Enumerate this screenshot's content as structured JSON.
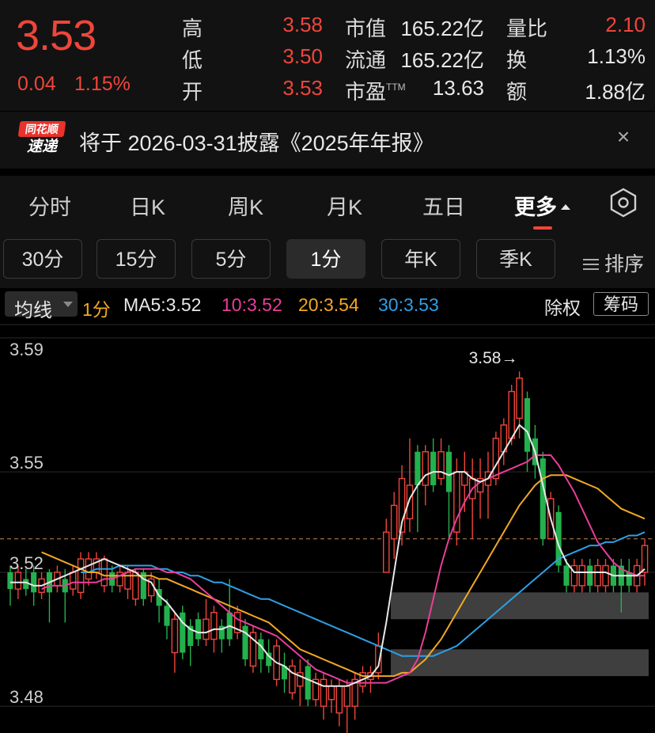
{
  "quote": {
    "price": "3.53",
    "change": "0.04",
    "change_pct": "1.15%",
    "metrics": [
      {
        "label": "高",
        "value": "3.58"
      },
      {
        "label": "低",
        "value": "3.50"
      },
      {
        "label": "开",
        "value": "3.53"
      }
    ],
    "stats_mid": [
      {
        "label": "市值",
        "value": "165.22亿"
      },
      {
        "label": "流通",
        "value": "165.22亿"
      },
      {
        "label": "市盈",
        "label_suffix": "TTM",
        "value": "13.63"
      }
    ],
    "stats_right": [
      {
        "label": "量比",
        "value": "2.10"
      },
      {
        "label": "换",
        "value": "1.13%"
      },
      {
        "label": "额",
        "value": "1.88亿"
      }
    ]
  },
  "news": {
    "logo_top": "同花顺",
    "logo_bottom": "速递",
    "text": "将于 2026-03-31披露《2025年年报》",
    "close": "×"
  },
  "tabs": [
    "分时",
    "日K",
    "周K",
    "月K",
    "五日",
    "更多"
  ],
  "tabs_active": "更多",
  "sub_periods": [
    "30分",
    "15分",
    "5分",
    "1分",
    "年K",
    "季K"
  ],
  "sub_active": "1分",
  "sort_label": "排序",
  "indicator": {
    "selector": "均线",
    "period": "1分",
    "ma5": "MA5:3.52",
    "ma10": "10:3.52",
    "ma20": "20:3.54",
    "ma30": "30:3.53",
    "fq": "除权",
    "chip": "筹码"
  },
  "colors": {
    "up": "#f0453a",
    "down": "#23b14d",
    "ma5": "#e8e8e8",
    "ma10": "#e83e9a",
    "ma20": "#f2a824",
    "ma30": "#2e9fe6",
    "period": "#f2a824"
  },
  "chart_data": {
    "type": "candlestick",
    "y_ticks": [
      "3.59",
      "3.55",
      "3.52",
      "3.48"
    ],
    "max_label": "3.58→",
    "ylim": [
      3.472,
      3.594
    ],
    "last_price": 3.53,
    "chip_band": [
      {
        "y_from": 3.506,
        "y_to": 3.514
      },
      {
        "y_from": 3.489,
        "y_to": 3.497
      }
    ],
    "candles": [
      [
        3.52,
        3.515,
        3.522,
        3.51
      ],
      [
        3.515,
        3.52,
        3.522,
        3.512
      ],
      [
        3.518,
        3.515,
        3.521,
        3.513
      ],
      [
        3.52,
        3.514,
        3.522,
        3.51
      ],
      [
        3.514,
        3.518,
        3.52,
        3.512
      ],
      [
        3.52,
        3.514,
        3.521,
        3.505
      ],
      [
        3.516,
        3.52,
        3.522,
        3.514
      ],
      [
        3.518,
        3.514,
        3.521,
        3.505
      ],
      [
        3.515,
        3.52,
        3.522,
        3.513
      ],
      [
        3.514,
        3.524,
        3.526,
        3.512
      ],
      [
        3.518,
        3.524,
        3.526,
        3.516
      ],
      [
        3.52,
        3.524,
        3.526,
        3.518
      ],
      [
        3.516,
        3.524,
        3.525,
        3.514
      ],
      [
        3.52,
        3.516,
        3.522,
        3.514
      ],
      [
        3.516,
        3.52,
        3.522,
        3.514
      ],
      [
        3.515,
        3.52,
        3.522,
        3.512
      ],
      [
        3.512,
        3.52,
        3.521,
        3.51
      ],
      [
        3.52,
        3.512,
        3.521,
        3.51
      ],
      [
        3.513,
        3.518,
        3.52,
        3.511
      ],
      [
        3.515,
        3.51,
        3.518,
        3.505
      ],
      [
        3.51,
        3.504,
        3.512,
        3.5
      ],
      [
        3.496,
        3.506,
        3.508,
        3.49
      ],
      [
        3.508,
        3.496,
        3.51,
        3.494
      ],
      [
        3.504,
        3.498,
        3.506,
        3.492
      ],
      [
        3.506,
        3.5,
        3.508,
        3.498
      ],
      [
        3.5,
        3.506,
        3.512,
        3.498
      ],
      [
        3.5,
        3.508,
        3.51,
        3.496
      ],
      [
        3.504,
        3.5,
        3.506,
        3.496
      ],
      [
        3.508,
        3.5,
        3.518,
        3.498
      ],
      [
        3.502,
        3.508,
        3.51,
        3.5
      ],
      [
        3.504,
        3.494,
        3.506,
        3.492
      ],
      [
        3.492,
        3.502,
        3.504,
        3.49
      ],
      [
        3.5,
        3.494,
        3.502,
        3.49
      ],
      [
        3.496,
        3.492,
        3.5,
        3.49
      ],
      [
        3.488,
        3.498,
        3.5,
        3.486
      ],
      [
        3.492,
        3.488,
        3.496,
        3.484
      ],
      [
        3.484,
        3.492,
        3.494,
        3.482
      ],
      [
        3.486,
        3.49,
        3.494,
        3.48
      ],
      [
        3.492,
        3.482,
        3.494,
        3.48
      ],
      [
        3.482,
        3.488,
        3.49,
        3.48
      ],
      [
        3.48,
        3.488,
        3.49,
        3.476
      ],
      [
        3.482,
        3.486,
        3.488,
        3.478
      ],
      [
        3.478,
        3.486,
        3.488,
        3.474
      ],
      [
        3.48,
        3.486,
        3.488,
        3.47
      ],
      [
        3.48,
        3.488,
        3.49,
        3.476
      ],
      [
        3.486,
        3.49,
        3.492,
        3.484
      ],
      [
        3.488,
        3.49,
        3.492,
        3.484
      ],
      [
        3.49,
        3.498,
        3.502,
        3.488
      ],
      [
        3.52,
        3.532,
        3.536,
        3.52
      ],
      [
        3.53,
        3.54,
        3.544,
        3.524
      ],
      [
        3.532,
        3.548,
        3.552,
        3.528
      ],
      [
        3.536,
        3.546,
        3.56,
        3.532
      ],
      [
        3.556,
        3.546,
        3.558,
        3.532
      ],
      [
        3.546,
        3.556,
        3.558,
        3.54
      ],
      [
        3.556,
        3.546,
        3.56,
        3.544
      ],
      [
        3.548,
        3.556,
        3.56,
        3.546
      ],
      [
        3.556,
        3.544,
        3.558,
        3.53
      ],
      [
        3.532,
        3.55,
        3.554,
        3.528
      ],
      [
        3.546,
        3.55,
        3.556,
        3.538
      ],
      [
        3.542,
        3.548,
        3.554,
        3.53
      ],
      [
        3.544,
        3.548,
        3.554,
        3.536
      ],
      [
        3.546,
        3.55,
        3.556,
        3.536
      ],
      [
        3.548,
        3.56,
        3.562,
        3.546
      ],
      [
        3.556,
        3.564,
        3.566,
        3.552
      ],
      [
        3.56,
        3.574,
        3.576,
        3.558
      ],
      [
        3.566,
        3.578,
        3.58,
        3.56
      ],
      [
        3.572,
        3.556,
        3.574,
        3.55
      ],
      [
        3.56,
        3.552,
        3.564,
        3.548
      ],
      [
        3.554,
        3.53,
        3.556,
        3.528
      ],
      [
        3.53,
        3.542,
        3.544,
        3.53
      ],
      [
        3.538,
        3.522,
        3.54,
        3.52
      ],
      [
        3.522,
        3.516,
        3.524,
        3.514
      ],
      [
        3.516,
        3.522,
        3.524,
        3.514
      ],
      [
        3.516,
        3.522,
        3.524,
        3.514
      ],
      [
        3.522,
        3.516,
        3.524,
        3.514
      ],
      [
        3.516,
        3.522,
        3.524,
        3.514
      ],
      [
        3.516,
        3.522,
        3.524,
        3.514
      ],
      [
        3.522,
        3.516,
        3.524,
        3.514
      ],
      [
        3.522,
        3.516,
        3.524,
        3.508
      ],
      [
        3.52,
        3.516,
        3.524,
        3.514
      ],
      [
        3.516,
        3.522,
        3.524,
        3.514
      ],
      [
        3.52,
        3.528,
        3.53,
        3.516
      ]
    ],
    "ma5": [
      3.517,
      3.517,
      3.517,
      3.516,
      3.516,
      3.517,
      3.518,
      3.519,
      3.52,
      3.521,
      3.522,
      3.523,
      3.524,
      3.523,
      3.522,
      3.521,
      3.52,
      3.518,
      3.517,
      3.513,
      3.511,
      3.508,
      3.505,
      3.503,
      3.502,
      3.502,
      3.503,
      3.503,
      3.504,
      3.503,
      3.502,
      3.5,
      3.498,
      3.495,
      3.493,
      3.492,
      3.49,
      3.489,
      3.488,
      3.487,
      3.486,
      3.486,
      3.486,
      3.486,
      3.487,
      3.488,
      3.489,
      3.492,
      3.505,
      3.52,
      3.535,
      3.542,
      3.546,
      3.549,
      3.55,
      3.55,
      3.549,
      3.55,
      3.55,
      3.548,
      3.547,
      3.548,
      3.552,
      3.556,
      3.56,
      3.564,
      3.562,
      3.556,
      3.546,
      3.536,
      3.528,
      3.523,
      3.52,
      3.52,
      3.52,
      3.52,
      3.52,
      3.519,
      3.519,
      3.519,
      3.519,
      3.521
    ],
    "ma10": [
      3.515,
      3.516,
      3.516,
      3.516,
      3.517,
      3.517,
      3.517,
      3.517,
      3.518,
      3.518,
      3.519,
      3.52,
      3.521,
      3.521,
      3.521,
      3.521,
      3.52,
      3.52,
      3.519,
      3.518,
      3.516,
      3.514,
      3.512,
      3.51,
      3.508,
      3.506,
      3.505,
      3.504,
      3.503,
      3.502,
      3.501,
      3.499,
      3.497,
      3.495,
      3.493,
      3.491,
      3.49,
      3.489,
      3.488,
      3.487,
      3.487,
      3.487,
      3.487,
      3.487,
      3.487,
      3.488,
      3.489,
      3.49,
      3.494,
      3.502,
      3.512,
      3.522,
      3.53,
      3.536,
      3.541,
      3.545,
      3.547,
      3.548,
      3.549,
      3.55,
      3.551,
      3.552,
      3.553,
      3.555,
      3.555,
      3.555,
      3.552,
      3.548,
      3.544,
      3.539,
      3.534,
      3.529,
      3.526,
      3.523,
      3.521,
      3.52,
      3.519,
      3.519
    ],
    "ma20": [
      3.526,
      3.525,
      3.524,
      3.523,
      3.522,
      3.521,
      3.52,
      3.52,
      3.519,
      3.519,
      3.519,
      3.519,
      3.519,
      3.519,
      3.519,
      3.518,
      3.518,
      3.517,
      3.516,
      3.515,
      3.514,
      3.513,
      3.512,
      3.511,
      3.51,
      3.509,
      3.508,
      3.507,
      3.506,
      3.505,
      3.503,
      3.501,
      3.499,
      3.497,
      3.496,
      3.495,
      3.494,
      3.493,
      3.492,
      3.491,
      3.49,
      3.489,
      3.489,
      3.489,
      3.489,
      3.489,
      3.49,
      3.49,
      3.492,
      3.494,
      3.497,
      3.5,
      3.504,
      3.508,
      3.512,
      3.516,
      3.52,
      3.524,
      3.528,
      3.532,
      3.536,
      3.54,
      3.543,
      3.546,
      3.548,
      3.549,
      3.549,
      3.549,
      3.548,
      3.547,
      3.546,
      3.545,
      3.543,
      3.541,
      3.539,
      3.538,
      3.537,
      3.536
    ],
    "ma30": [
      3.52,
      3.52,
      3.521,
      3.521,
      3.521,
      3.522,
      3.522,
      3.522,
      3.522,
      3.522,
      3.521,
      3.521,
      3.52,
      3.52,
      3.519,
      3.519,
      3.518,
      3.517,
      3.517,
      3.516,
      3.515,
      3.514,
      3.513,
      3.512,
      3.512,
      3.511,
      3.51,
      3.509,
      3.508,
      3.507,
      3.506,
      3.505,
      3.504,
      3.503,
      3.502,
      3.501,
      3.5,
      3.499,
      3.498,
      3.497,
      3.496,
      3.495,
      3.495,
      3.495,
      3.495,
      3.495,
      3.496,
      3.497,
      3.498,
      3.5,
      3.502,
      3.504,
      3.506,
      3.508,
      3.51,
      3.512,
      3.514,
      3.516,
      3.518,
      3.52,
      3.522,
      3.524,
      3.525,
      3.526,
      3.527,
      3.528,
      3.528,
      3.529,
      3.529,
      3.53,
      3.531,
      3.531,
      3.532
    ]
  }
}
